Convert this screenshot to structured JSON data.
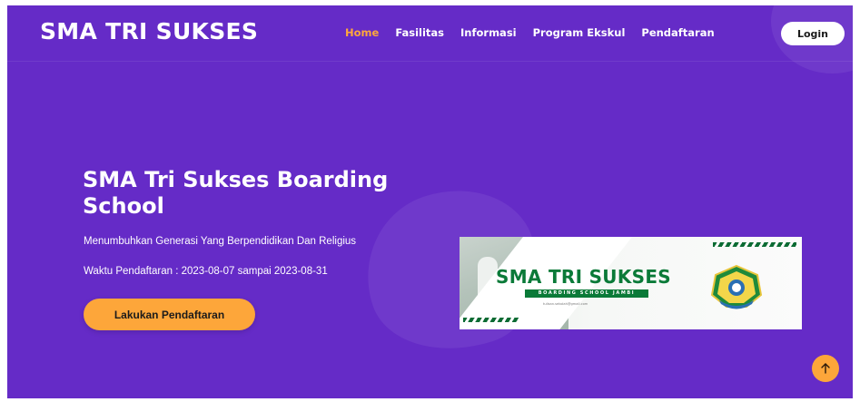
{
  "navbar": {
    "brand": "SMA TRI SUKSES",
    "links": [
      {
        "label": "Home",
        "active": true
      },
      {
        "label": "Fasilitas",
        "active": false
      },
      {
        "label": "Informasi",
        "active": false
      },
      {
        "label": "Program Ekskul",
        "active": false
      },
      {
        "label": "Pendaftaran",
        "active": false
      }
    ],
    "login_label": "Login"
  },
  "hero": {
    "title": "SMA Tri Sukses Boarding School",
    "subtitle": "Menumbuhkan Generasi Yang Berpendidikan Dan Religius",
    "registration_period": "Waktu Pendaftaran : 2023-08-07 sampai 2023-08-31",
    "cta_label": "Lakukan Pendaftaran"
  },
  "banner": {
    "title": "SMA TRI SUKSES",
    "subtitle": "BOARDING SCHOOL JAMBI",
    "tagline": "tulisan.sekolah@gmail.com"
  },
  "icons": {
    "back_to_top": "arrow-up-icon",
    "seal": "school-seal-icon"
  },
  "colors": {
    "background": "#652bc7",
    "accent": "#fda63a",
    "active_link": "#ffa73b",
    "banner_green": "#0a7a38"
  }
}
